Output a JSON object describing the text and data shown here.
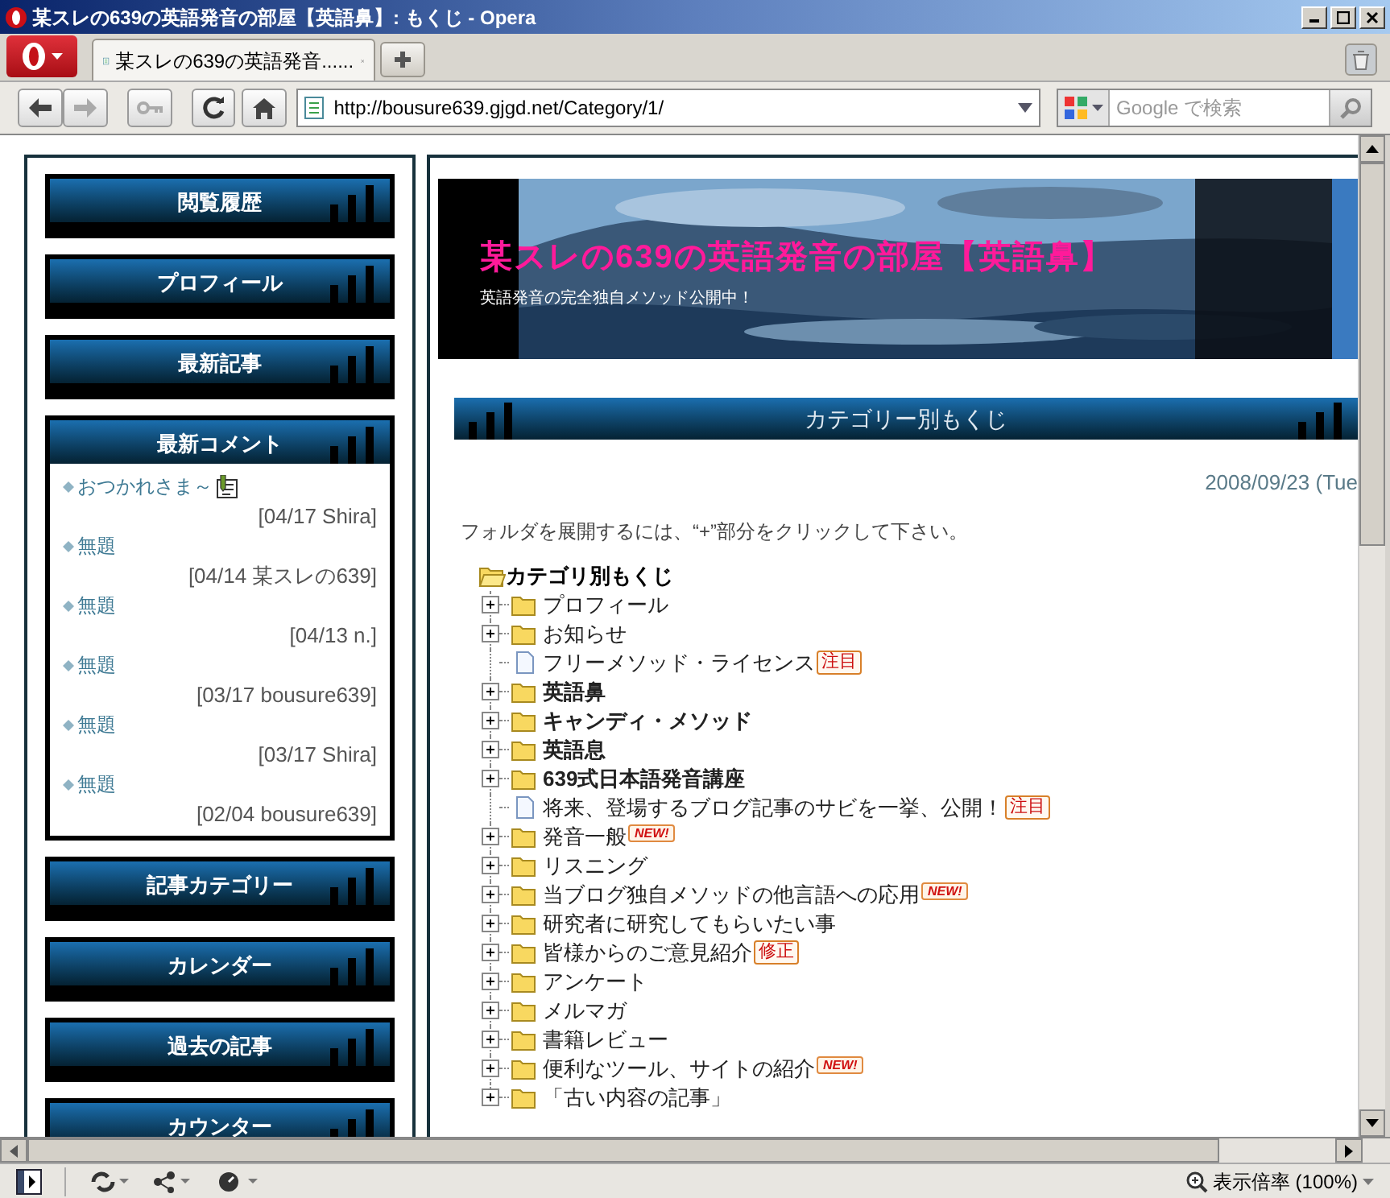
{
  "window": {
    "title": "某スレの639の英語発音の部屋【英語鼻】: もくじ - Opera"
  },
  "tabs": [
    {
      "label": "某スレの639の英語発音......",
      "selected": true
    }
  ],
  "address": {
    "url": "http://bousure639.gjgd.net/Category/1/"
  },
  "search": {
    "placeholder": "Google で検索"
  },
  "sidebar": {
    "widgets": [
      {
        "title": "閲覧履歴",
        "kind": "heading"
      },
      {
        "title": "プロフィール",
        "kind": "heading"
      },
      {
        "title": "最新記事",
        "kind": "heading"
      },
      {
        "title": "最新コメント",
        "kind": "comments",
        "comments": [
          {
            "title": "おつかれさま～",
            "meta": "[04/17 Shira]",
            "memo": true
          },
          {
            "title": "無題",
            "meta": "[04/14 某スレの639]",
            "memo": false
          },
          {
            "title": "無題",
            "meta": "[04/13 n.]",
            "memo": false
          },
          {
            "title": "無題",
            "meta": "[03/17 bousure639]",
            "memo": false
          },
          {
            "title": "無題",
            "meta": "[03/17 Shira]",
            "memo": false
          },
          {
            "title": "無題",
            "meta": "[02/04 bousure639]",
            "memo": false
          }
        ]
      },
      {
        "title": "記事カテゴリー",
        "kind": "heading"
      },
      {
        "title": "カレンダー",
        "kind": "heading"
      },
      {
        "title": "過去の記事",
        "kind": "heading"
      },
      {
        "title": "カウンター",
        "kind": "heading"
      }
    ]
  },
  "banner": {
    "title": "某スレの639の英語発音の部屋【英語鼻】",
    "subtitle": "英語発音の完全独自メソッド公開中！"
  },
  "section": {
    "heading": "カテゴリー別もくじ",
    "date": "2008/09/23 (Tue",
    "instruction": "フォルダを展開するには、“+”部分をクリックして下さい。"
  },
  "tree": {
    "label": "カテゴリ別もくじ",
    "children": [
      {
        "label": "プロフィール",
        "kind": "folder",
        "bold": false
      },
      {
        "label": "お知らせ",
        "kind": "folder",
        "bold": false
      },
      {
        "label": "フリーメソッド・ライセンス",
        "kind": "page",
        "bold": false,
        "badge": {
          "text": "注目",
          "kind": "label"
        }
      },
      {
        "label": "英語鼻",
        "kind": "folder",
        "bold": true
      },
      {
        "label": "キャンディ・メソッド",
        "kind": "folder",
        "bold": true
      },
      {
        "label": "英語息",
        "kind": "folder",
        "bold": true
      },
      {
        "label": "639式日本語発音講座",
        "kind": "folder",
        "bold": true
      },
      {
        "label": "将来、登場するブログ記事のサビを一挙、公開！",
        "kind": "page",
        "bold": false,
        "badge": {
          "text": "注目",
          "kind": "label"
        }
      },
      {
        "label": "発音一般",
        "kind": "folder",
        "bold": false,
        "badge": {
          "text": "NEW!",
          "kind": "new"
        }
      },
      {
        "label": "リスニング",
        "kind": "folder",
        "bold": false
      },
      {
        "label": "当ブログ独自メソッドの他言語への応用",
        "kind": "folder",
        "bold": false,
        "badge": {
          "text": "NEW!",
          "kind": "new"
        }
      },
      {
        "label": "研究者に研究してもらいたい事",
        "kind": "folder",
        "bold": false
      },
      {
        "label": "皆様からのご意見紹介",
        "kind": "folder",
        "bold": false,
        "badge": {
          "text": "修正",
          "kind": "label"
        }
      },
      {
        "label": "アンケート",
        "kind": "folder",
        "bold": false
      },
      {
        "label": "メルマガ",
        "kind": "folder",
        "bold": false
      },
      {
        "label": "書籍レビュー",
        "kind": "folder",
        "bold": false
      },
      {
        "label": "便利なツール、サイトの紹介",
        "kind": "folder",
        "bold": false,
        "badge": {
          "text": "NEW!",
          "kind": "new"
        }
      },
      {
        "label": "「古い内容の記事」",
        "kind": "folder",
        "bold": false
      }
    ]
  },
  "status": {
    "zoom": "表示倍率 (100%)"
  }
}
